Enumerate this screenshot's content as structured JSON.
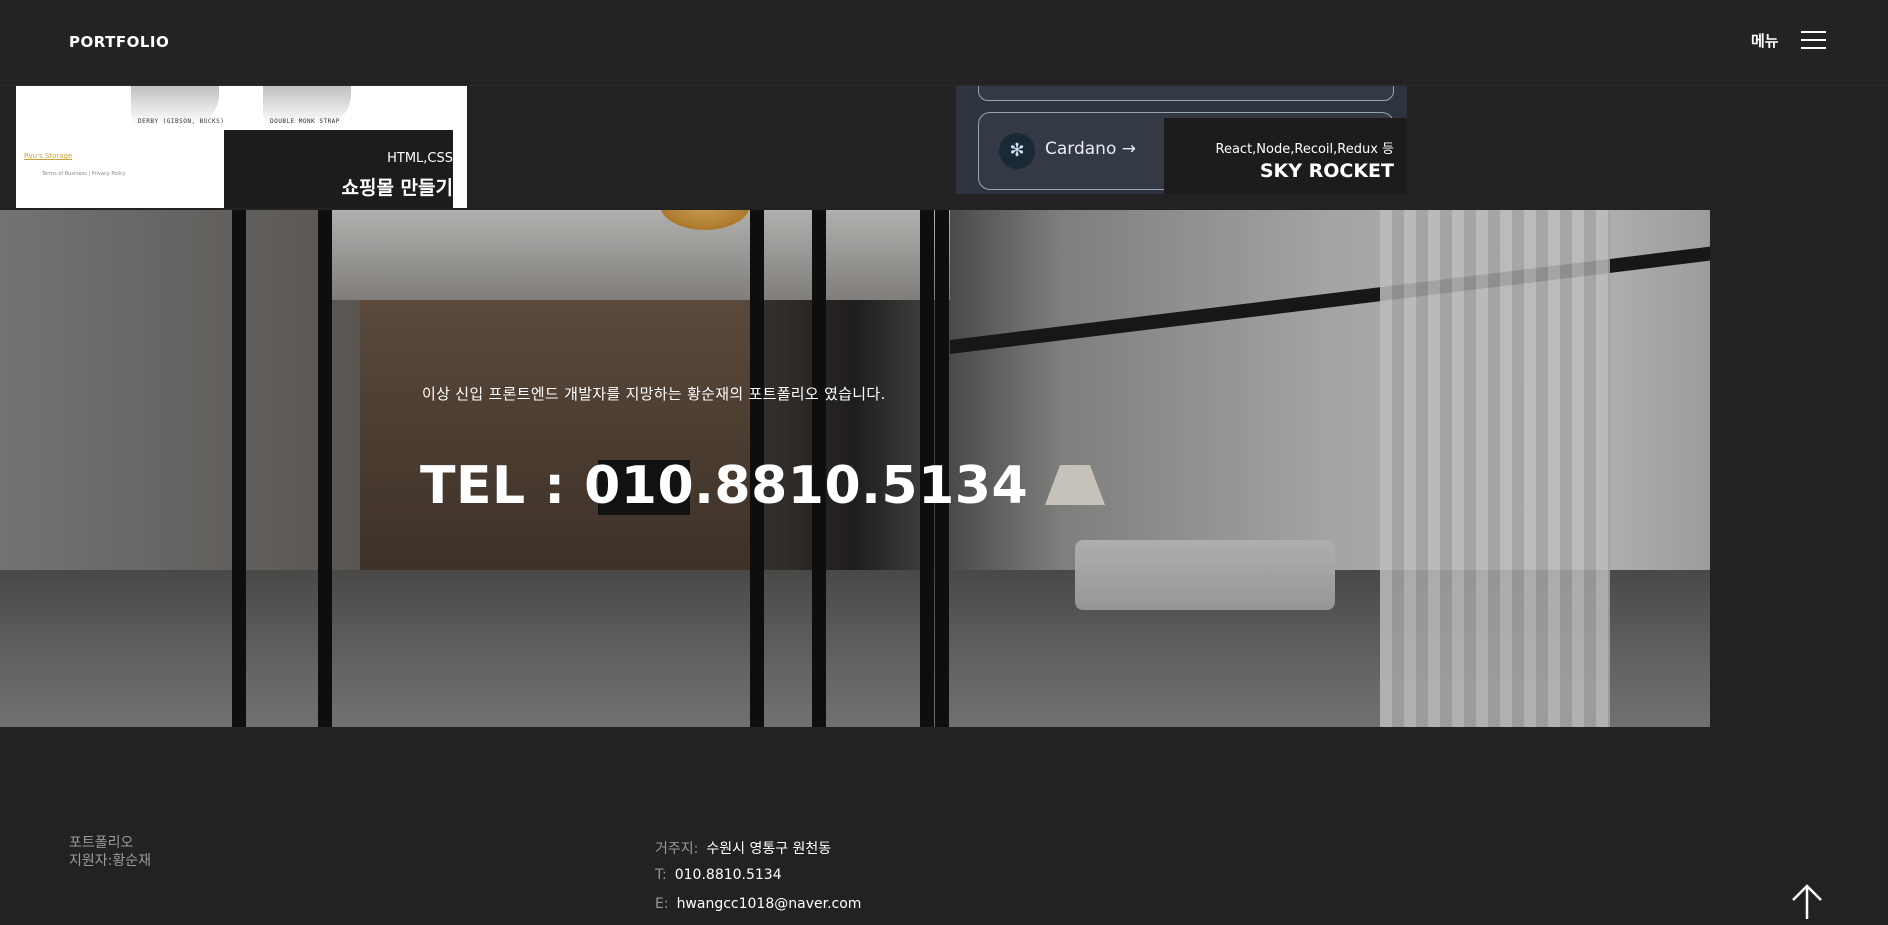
{
  "header": {
    "logo": "PORTFOLIO",
    "menu_label": "메뉴",
    "menu_icon": "hamburger-icon"
  },
  "projects": [
    {
      "tags": "HTML,CSS",
      "title": "쇼핑몰 만들기",
      "thumbnail": {
        "captions": [
          "DERBY (GIBSON, BUCKS)",
          "DOUBLE MONK STRAP"
        ],
        "link": "Ryu's Storage",
        "nav": "Terms of Business  |  Privacy Policy"
      }
    },
    {
      "tags": "React,Node,Recoil,Redux 등",
      "title": "SKY ROCKET",
      "thumbnail": {
        "coin_name": "Cardano →",
        "coin_icon": "cardano-icon"
      }
    }
  ],
  "hero": {
    "subtitle": "이상 신입 프론트엔드 개발자를 지망하는 황순재의 포트폴리오 였습니다.",
    "tel": "TEL : 010.8810.5134"
  },
  "footer": {
    "left_line1": "포트폴리오",
    "left_line2": "지원자:황순재",
    "address_label": "거주지:",
    "address": "수원시 영통구 원천동",
    "phone_label": "T:",
    "phone": "010.8810.5134",
    "email_label": "E:",
    "email": "hwangcc1018@naver.com",
    "scroll_top_icon": "arrow-up-icon"
  }
}
